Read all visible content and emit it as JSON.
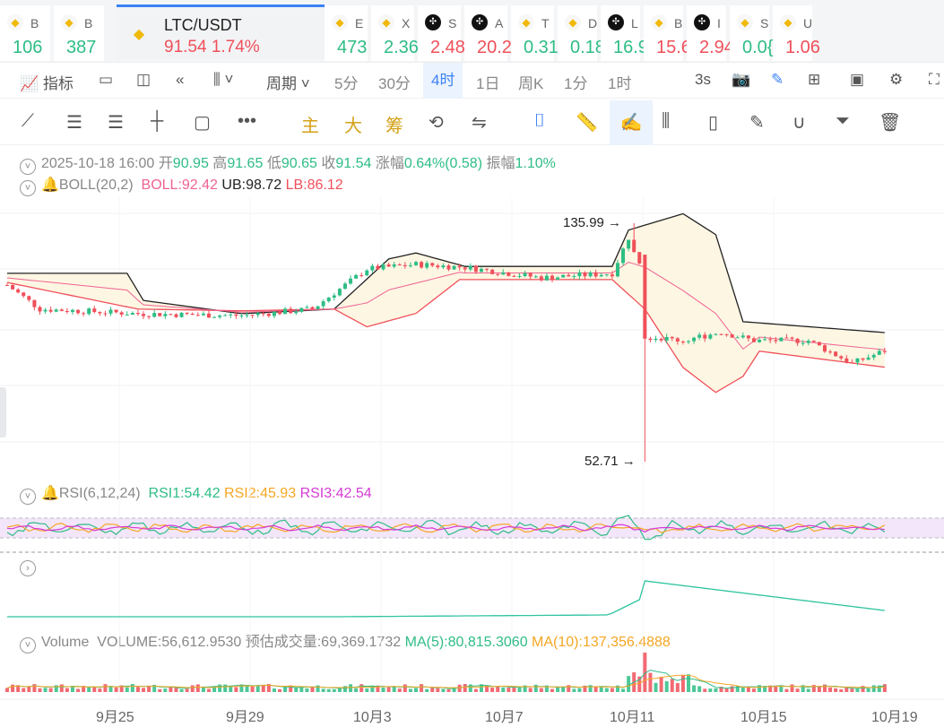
{
  "tickers": [
    {
      "name": "B",
      "price": "106",
      "dir": "up",
      "icon": "binance"
    },
    {
      "name": "B",
      "price": "387",
      "dir": "up",
      "icon": "binance"
    },
    {
      "name": "LTC/USDT",
      "price": "91.54",
      "change": "1.74%",
      "dir": "dn",
      "icon": "binance",
      "active": true
    },
    {
      "name": "E",
      "price": "473",
      "dir": "up",
      "icon": "binance"
    },
    {
      "name": "X",
      "price": "2.36",
      "dir": "up",
      "icon": "binance"
    },
    {
      "name": "S",
      "price": "2.48",
      "dir": "dn",
      "icon": "okx"
    },
    {
      "name": "A",
      "price": "20.2",
      "dir": "dn",
      "icon": "okx"
    },
    {
      "name": "T",
      "price": "0.31",
      "dir": "up",
      "icon": "binance"
    },
    {
      "name": "D",
      "price": "0.18",
      "dir": "up",
      "icon": "binance"
    },
    {
      "name": "L",
      "price": "16.9",
      "dir": "up",
      "icon": "okx"
    },
    {
      "name": "B",
      "price": "15.6",
      "dir": "dn",
      "icon": "binance"
    },
    {
      "name": "I",
      "price": "2.94",
      "dir": "dn",
      "icon": "okx"
    },
    {
      "name": "S",
      "price": "0.0{",
      "dir": "up",
      "icon": "binance"
    },
    {
      "name": "U",
      "price": "1.06",
      "dir": "dn",
      "icon": "binance"
    }
  ],
  "toolbar": {
    "indicators": "指标",
    "period": "周期",
    "periods": [
      "5分",
      "30分",
      "4时",
      "1日",
      "周K",
      "1分",
      "1时"
    ],
    "selected_period": "4时",
    "refresh": "3s"
  },
  "drawbar": {
    "main": "主",
    "big": "大",
    "chips": "筹"
  },
  "ohlc": {
    "time": "2025-10-18 16:00",
    "open_l": "开",
    "open": "90.95",
    "high_l": "高",
    "high": "91.65",
    "low_l": "低",
    "low": "90.65",
    "close_l": "收",
    "close": "91.54",
    "chg_l": "涨幅",
    "chg": "0.64%(0.58)",
    "amp_l": "振幅",
    "amp": "1.10%"
  },
  "boll": {
    "name": "BOLL(20,2)",
    "mid": "BOLL:92.42",
    "ub": "UB:98.72",
    "lb": "LB:86.12"
  },
  "rsi": {
    "name": "RSI(6,12,24)",
    "rsi1": "RSI1:54.42",
    "rsi2": "RSI2:45.93",
    "rsi3": "RSI3:42.54"
  },
  "volume": {
    "name": "Volume",
    "vol": "VOLUME:56,612.9530",
    "est": "预估成交量:69,369.1732",
    "ma5": "MA(5):80,815.3060",
    "ma10": "MA(10):137,356.4888"
  },
  "markers": {
    "high": "135.99",
    "low": "52.71"
  },
  "x_axis": [
    "9月25",
    "9月29",
    "10月3",
    "10月7",
    "10月11",
    "10月15",
    "10月19"
  ],
  "colors": {
    "up": "#2ebd85",
    "down": "#f0505a",
    "accent": "#3b82f6",
    "ub": "#222222",
    "lb": "#f0505a",
    "mid": "#f06292"
  },
  "chart_data": {
    "type": "candlestick",
    "candles": 162,
    "close_path": [
      [
        0,
        114.4
      ],
      [
        6,
        106
      ],
      [
        24,
        104.4
      ],
      [
        43,
        103.7
      ],
      [
        56,
        106
      ],
      [
        66,
        120
      ],
      [
        75,
        121.6
      ],
      [
        84,
        120.6
      ],
      [
        98,
        116.9
      ],
      [
        111,
        118.5
      ],
      [
        114,
        131
      ],
      [
        116,
        123
      ],
      [
        117,
        96.5
      ],
      [
        124,
        95
      ],
      [
        131,
        98
      ],
      [
        137,
        95
      ],
      [
        147,
        95
      ],
      [
        155,
        87
      ],
      [
        161,
        91.5
      ]
    ],
    "upper_band": [
      [
        0,
        118.5
      ],
      [
        22,
        118.5
      ],
      [
        25,
        109
      ],
      [
        43,
        104.4
      ],
      [
        60,
        106
      ],
      [
        70,
        123.5
      ],
      [
        75,
        125.6
      ],
      [
        84,
        120.9
      ],
      [
        111,
        120.9
      ],
      [
        114,
        133.6
      ],
      [
        124,
        139.3
      ],
      [
        130,
        132
      ],
      [
        135,
        101.6
      ],
      [
        161,
        97.8
      ]
    ],
    "lower_band": [
      [
        0,
        115.3
      ],
      [
        24,
        106
      ],
      [
        43,
        105.4
      ],
      [
        60,
        106
      ],
      [
        66,
        99.8
      ],
      [
        75,
        104.5
      ],
      [
        83,
        116.3
      ],
      [
        111,
        116.3
      ],
      [
        117,
        106
      ],
      [
        124,
        85.6
      ],
      [
        130,
        76.9
      ],
      [
        135,
        82.5
      ],
      [
        138,
        91.3
      ],
      [
        161,
        85.7
      ]
    ],
    "extreme_high": {
      "index": 115,
      "value": 135.99
    },
    "extreme_low": {
      "index": 117,
      "value": 52.71
    },
    "volume_spike_index": 117
  }
}
